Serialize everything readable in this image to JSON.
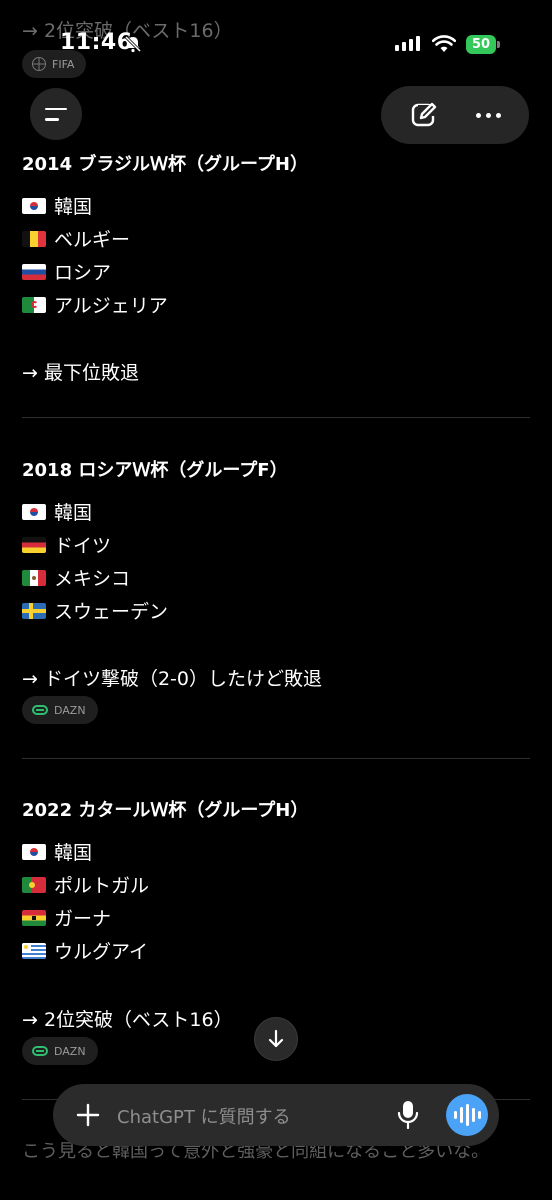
{
  "status": {
    "time": "11:46",
    "battery": "50"
  },
  "top_ghost": {
    "text": "→ 2位突破（ベスト16）",
    "source": "FIFA"
  },
  "sections": [
    {
      "heading": "2014 ブラジルＷ杯（グループH）",
      "teams": [
        "韓国",
        "ベルギー",
        "ロシア",
        "アルジェリア"
      ],
      "result": "→ 最下位敗退",
      "source": ""
    },
    {
      "heading": "2018 ロシアＷ杯（グループF）",
      "teams": [
        "韓国",
        "ドイツ",
        "メキシコ",
        "スウェーデン"
      ],
      "result": "→ ドイツ撃破（2-0）したけど敗退",
      "source": "DAZN"
    },
    {
      "heading": "2022 カタールＷ杯（グループH）",
      "teams": [
        "韓国",
        "ポルトガル",
        "ガーナ",
        "ウルグアイ"
      ],
      "result": "→ 2位突破（ベスト16）",
      "source": "DAZN"
    }
  ],
  "composer": {
    "placeholder": "ChatGPT に質問する"
  },
  "bottom_text": "こう見ると韓国って意外と強豪と同組になること多いな。",
  "icons": {
    "menu": "menu-icon",
    "new_chat": "edit-icon",
    "more": "more-icon",
    "scroll": "arrow-down-icon",
    "plus": "plus-icon",
    "mic": "microphone-icon",
    "voice": "voice-mode-icon"
  },
  "colors": {
    "accent": "#4aa3f7",
    "battery": "#34c759",
    "source_icon": "#2fbf71"
  }
}
